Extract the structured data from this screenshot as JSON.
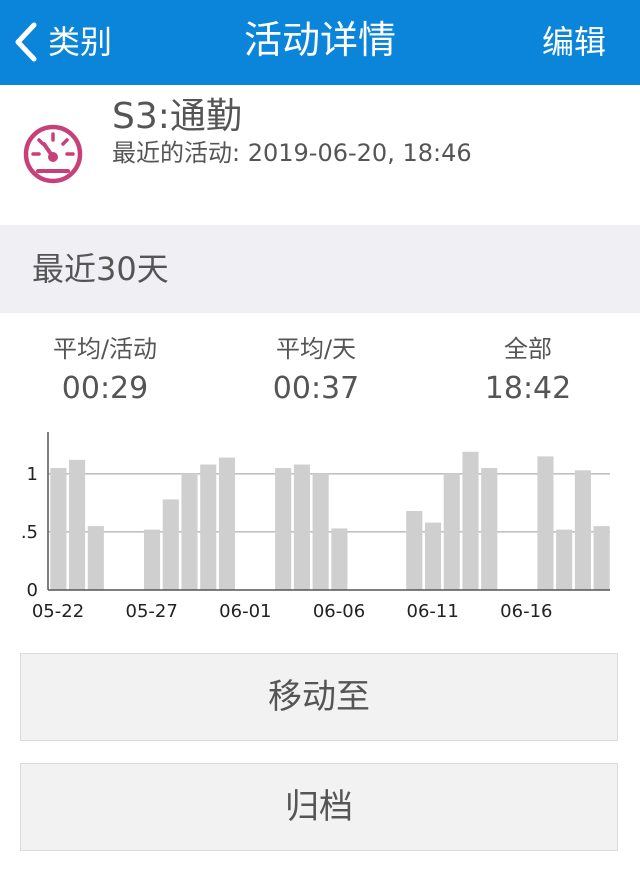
{
  "nav": {
    "back_label": "类别",
    "title": "活动详情",
    "edit_label": "编辑"
  },
  "activity": {
    "name": "S3:通勤",
    "recent": "最近的活动: 2019-06-20, 18:46",
    "icon": "speedometer-icon",
    "icon_color": "#c8407a"
  },
  "section": {
    "title": "最近30天"
  },
  "stats": [
    {
      "label": "平均/活动",
      "value": "00:29"
    },
    {
      "label": "平均/天",
      "value": "00:37"
    },
    {
      "label": "全部",
      "value": "18:42"
    }
  ],
  "chart_data": {
    "type": "bar",
    "x_tick_labels": [
      "05-22",
      "05-27",
      "06-01",
      "06-06",
      "06-11",
      "06-16"
    ],
    "categories": [
      "05-22",
      "05-23",
      "05-24",
      "05-25",
      "05-26",
      "05-27",
      "05-28",
      "05-29",
      "05-30",
      "05-31",
      "06-01",
      "06-02",
      "06-03",
      "06-04",
      "06-05",
      "06-06",
      "06-07",
      "06-08",
      "06-09",
      "06-10",
      "06-11",
      "06-12",
      "06-13",
      "06-14",
      "06-15",
      "06-16",
      "06-17",
      "06-18",
      "06-19",
      "06-20"
    ],
    "values": [
      1.05,
      1.12,
      0.55,
      0,
      0,
      0.52,
      0.78,
      1.0,
      1.08,
      1.14,
      0,
      0,
      1.05,
      1.08,
      1.0,
      0.53,
      0,
      0,
      0,
      0.68,
      0.58,
      1.0,
      1.19,
      1.05,
      0,
      0,
      1.15,
      0.52,
      1.03,
      0.55
    ],
    "y_tick_labels": [
      "0",
      ".5",
      "1"
    ],
    "y_ticks": [
      0,
      0.5,
      1
    ],
    "ylim": [
      0,
      1.36
    ],
    "grid": true,
    "bar_color": "#cfcfcf"
  },
  "actions": {
    "move_label": "移动至",
    "archive_label": "归档"
  }
}
